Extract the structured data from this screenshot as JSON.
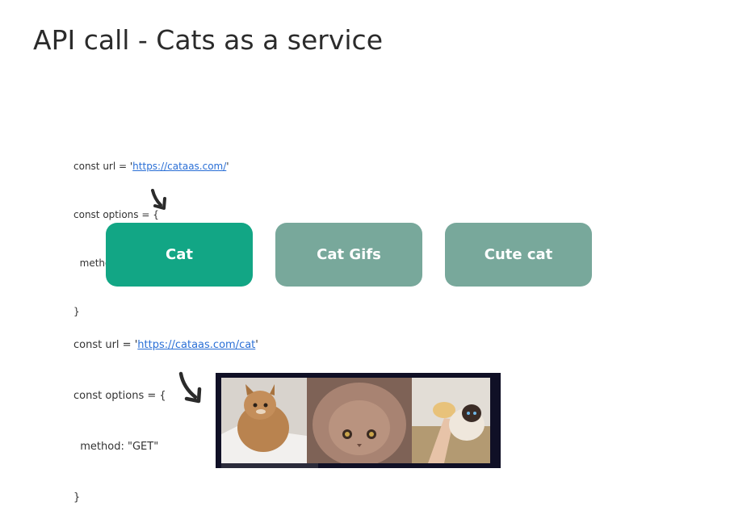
{
  "page": {
    "title": "API call - Cats as a service"
  },
  "snippet_top": {
    "line1_prefix": "const url = '",
    "link": "https://cataas.com/",
    "line1_suffix": "'",
    "line2": "const options = {",
    "line3": "  method: \"GET\"",
    "line4": "}"
  },
  "buttons": [
    {
      "label": "Cat",
      "color": "#12a685",
      "state": "active"
    },
    {
      "label": "Cat Gifs",
      "color": "#78a89b",
      "state": "inactive"
    },
    {
      "label": "Cute cat",
      "color": "#78a89b",
      "state": "inactive"
    }
  ],
  "snippet_bottom": {
    "line1_prefix": "const url = '",
    "link": "https://cataas.com/cat",
    "line1_suffix": "'",
    "line2": "const options = {",
    "line3": "  method: \"GET\"",
    "line4": "}"
  },
  "result_image": {
    "panels": [
      "cat-in-bathtub",
      "fluffy-cat-face",
      "cat-with-bread"
    ]
  },
  "colors": {
    "link": "#2a6fd6",
    "accent": "#12a685",
    "muted_button": "#78a89b"
  }
}
